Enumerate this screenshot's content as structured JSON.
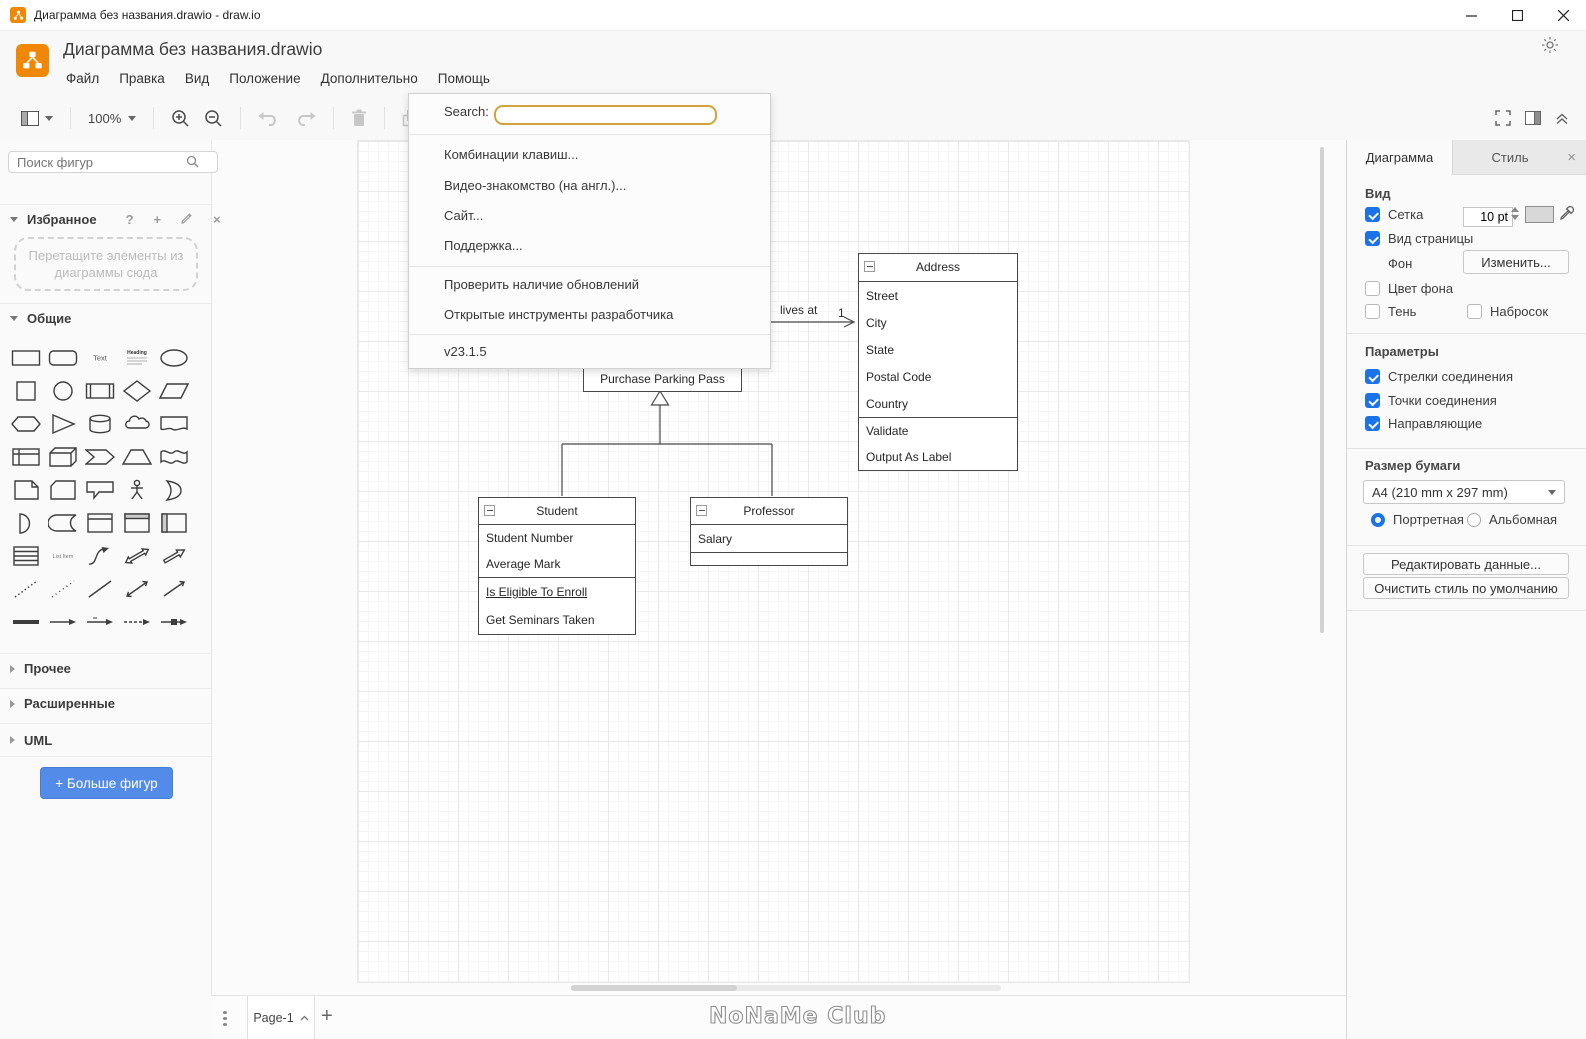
{
  "window": {
    "title": "Диаграмма без названия.drawio - draw.io"
  },
  "header": {
    "app_title": "Диаграмма без названия.drawio",
    "menus": [
      "Файл",
      "Правка",
      "Вид",
      "Положение",
      "Дополнительно",
      "Помощь"
    ]
  },
  "toolbar": {
    "zoom_level": "100%"
  },
  "help_menu": {
    "search_label": "Search:",
    "items": [
      "Комбинации клавиш...",
      "Видео-знакомство (на англ.)...",
      "Сайт...",
      "Поддержка..."
    ],
    "items2": [
      "Проверить наличие обновлений",
      "Открытые инструменты разработчика"
    ],
    "version": "v23.1.5"
  },
  "sidebar": {
    "search_placeholder": "Поиск фигур",
    "favorites": {
      "title": "Избранное",
      "hint_line1": "Перетащите элементы из",
      "hint_line2": "диаграммы сюда"
    },
    "sections": {
      "general": "Общие",
      "misc": "Прочее",
      "advanced": "Расширенные",
      "uml": "UML"
    },
    "more_shapes": "+ Больше фигур",
    "shapes": [
      "rectangle",
      "rounded-rectangle",
      "text",
      "textbox",
      "ellipse",
      "square",
      "circle",
      "process",
      "diamond",
      "parallelogram",
      "hexagon",
      "triangle",
      "cylinder",
      "cloud",
      "document",
      "internal-storage",
      "cube",
      "step",
      "trapezoid",
      "tape",
      "note",
      "card",
      "callout",
      "actor",
      "or",
      "and",
      "data-storage",
      "container",
      "vertical-container",
      "horizontal-container",
      "list",
      "list-item",
      "curve",
      "bidirectional-arrow",
      "arrow",
      "dashed-line",
      "dotted-line",
      "line",
      "bidirectional-connector",
      "directional-connector",
      "link",
      "directional-edge",
      "labeled-edge",
      "dashed-edge",
      "annotated-edge"
    ]
  },
  "canvas": {
    "classes": {
      "purchase": {
        "title": "Purchase Parking Pass"
      },
      "student": {
        "title": "Student",
        "attributes": [
          "Student Number",
          "Average Mark"
        ],
        "methods": [
          "Is Eligible To Enroll",
          "Get Seminars Taken"
        ]
      },
      "professor": {
        "title": "Professor",
        "attributes": [
          "Salary"
        ]
      },
      "address": {
        "title": "Address",
        "attributes": [
          "Street",
          "City",
          "State",
          "Postal Code",
          "Country"
        ],
        "methods": [
          "Validate",
          "Output As Label"
        ]
      }
    },
    "edge": {
      "label": "lives at",
      "multiplicity": "1"
    },
    "watermark": "NoNaMe Club"
  },
  "footer": {
    "page_tab": "Page-1"
  },
  "panel": {
    "tabs": {
      "diagram": "Диаграмма",
      "style": "Стиль"
    },
    "view": {
      "title": "Вид",
      "grid_label": "Сетка",
      "grid_size": "10 pt",
      "page_view": "Вид страницы",
      "background_label": "Фон",
      "change_button": "Изменить...",
      "bg_color": "Цвет фона",
      "shadow": "Тень",
      "sketch": "Набросок"
    },
    "options": {
      "title": "Параметры",
      "items": [
        "Стрелки соединения",
        "Точки соединения",
        "Направляющие"
      ]
    },
    "paper": {
      "title": "Размер бумаги",
      "size": "A4 (210 mm x 297 mm)",
      "portrait": "Портретная",
      "landscape": "Альбомная"
    },
    "buttons": [
      "Редактировать данные...",
      "Очистить стиль по умолчанию"
    ]
  },
  "colors": {
    "accent_blue": "#1a73e8",
    "brand_orange": "#F08705",
    "more_shapes_blue": "#528be8",
    "search_border_gold": "#d1a33c"
  }
}
